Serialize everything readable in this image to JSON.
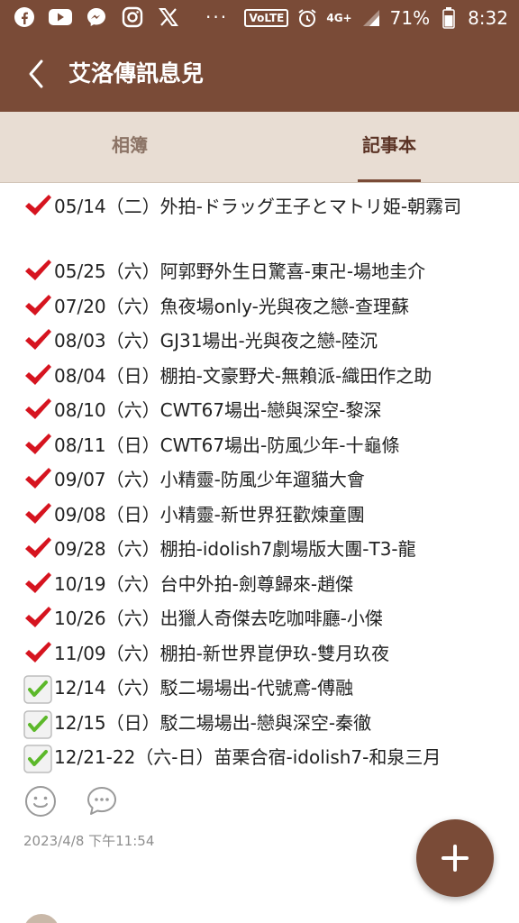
{
  "status_bar": {
    "volte": "VoLTE",
    "network": "4G+",
    "battery": "71%",
    "time": "8:32",
    "more": "···"
  },
  "header": {
    "title": "艾洛傳訊息兒"
  },
  "tabs": [
    {
      "label": "相簿",
      "active": false
    },
    {
      "label": "記事本",
      "active": true
    }
  ],
  "entries": [
    {
      "text": "05/14（二）外拍-ドラッグ王子とマトリ姫-朝霧司",
      "mark": "red-check"
    },
    {
      "text": "05/25（六）阿郭野外生日驚喜-東卍-場地圭介",
      "mark": "red-check"
    },
    {
      "text": "07/20（六）魚夜場only-光與夜之戀-查理蘇",
      "mark": "red-check"
    },
    {
      "text": "08/03（六）GJ31場出-光與夜之戀-陸沉",
      "mark": "red-check"
    },
    {
      "text": "08/04（日）棚拍-文豪野犬-無賴派-織田作之助",
      "mark": "red-check"
    },
    {
      "text": "08/10（六）CWT67場出-戀與深空-黎深",
      "mark": "red-check"
    },
    {
      "text": "08/11（日）CWT67場出-防風少年-十龜條",
      "mark": "red-check"
    },
    {
      "text": "09/07（六）小精靈-防風少年遛貓大會",
      "mark": "red-check"
    },
    {
      "text": "09/08（日）小精靈-新世界狂歡煉童團",
      "mark": "red-check"
    },
    {
      "text": "09/28（六）棚拍-idolish7劇場版大團-T3-龍",
      "mark": "red-check"
    },
    {
      "text": "10/19（六）台中外拍-劍尊歸來-趙傑",
      "mark": "red-check"
    },
    {
      "text": "10/26（六）出獵人奇傑去吃咖啡廳-小傑",
      "mark": "red-check"
    },
    {
      "text": "11/09（六）棚拍-新世界崑伊玖-雙月玖夜",
      "mark": "red-check"
    },
    {
      "text": "12/14（六）駁二場場出-代號鳶-傅融",
      "mark": "green-checkbox"
    },
    {
      "text": "12/15（日）駁二場場出-戀與深空-秦徹",
      "mark": "green-checkbox"
    },
    {
      "text": "12/21-22（六-日）苗栗合宿-idolish7-和泉三月",
      "mark": "green-checkbox"
    }
  ],
  "post": {
    "timestamp": "2023/4/8 下午11:54",
    "actions": [
      "smiley-icon",
      "comment-icon"
    ]
  },
  "fab": {
    "icon": "plus-icon"
  },
  "colors": {
    "brand": "#7a4b37",
    "tab_bg": "#e8ddd3",
    "red_check": "#d6141f",
    "green_check": "#5cb82a"
  }
}
